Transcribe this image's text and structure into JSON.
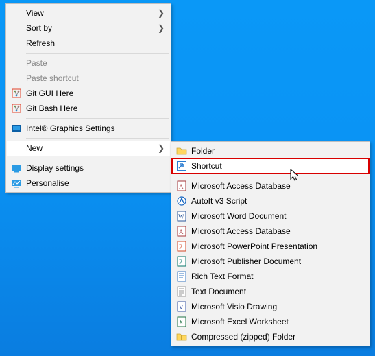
{
  "menu1": {
    "view": "View",
    "sort_by": "Sort by",
    "refresh": "Refresh",
    "paste": "Paste",
    "paste_shortcut": "Paste shortcut",
    "git_gui": "Git GUI Here",
    "git_bash": "Git Bash Here",
    "intel_gfx": "Intel® Graphics Settings",
    "new": "New",
    "display_settings": "Display settings",
    "personalise": "Personalise"
  },
  "menu2": {
    "folder": "Folder",
    "shortcut": "Shortcut",
    "access_db": "Microsoft Access Database",
    "autoit": "AutoIt v3 Script",
    "word": "Microsoft Word Document",
    "access_db2": "Microsoft Access Database",
    "ppt": "Microsoft PowerPoint Presentation",
    "publisher": "Microsoft Publisher Document",
    "rtf": "Rich Text Format",
    "txt": "Text Document",
    "visio": "Microsoft Visio Drawing",
    "excel": "Microsoft Excel Worksheet",
    "zip": "Compressed (zipped) Folder"
  }
}
